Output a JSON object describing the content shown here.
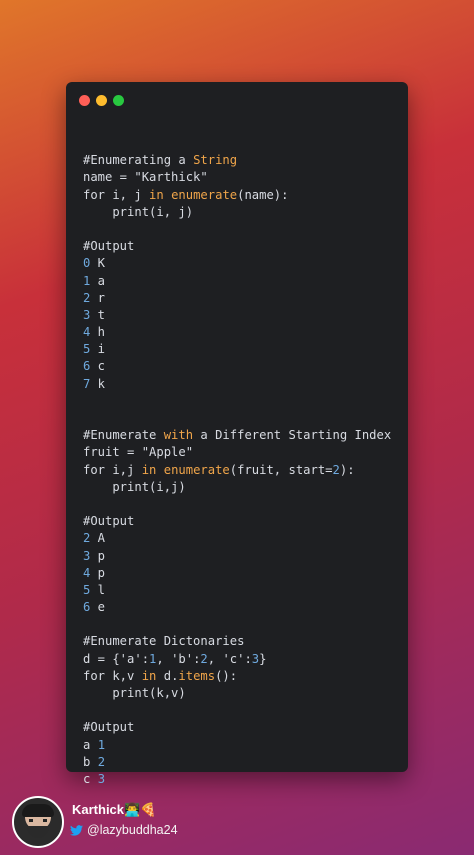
{
  "code": {
    "lines": [
      "",
      [
        {
          "t": "#Enumerating a ",
          "c": "txt"
        },
        {
          "t": "String",
          "c": "kw"
        }
      ],
      [
        {
          "t": "name = \"Karthick\"",
          "c": "txt"
        }
      ],
      [
        {
          "t": "for i, j ",
          "c": "txt"
        },
        {
          "t": "in",
          "c": "kw"
        },
        {
          "t": " ",
          "c": "txt"
        },
        {
          "t": "enumerate",
          "c": "fn"
        },
        {
          "t": "(name):",
          "c": "txt"
        }
      ],
      [
        {
          "t": "    print(i, j)",
          "c": "txt"
        }
      ],
      "",
      [
        {
          "t": "#Output",
          "c": "txt"
        }
      ],
      [
        {
          "t": "0",
          "c": "num"
        },
        {
          "t": " K",
          "c": "txt"
        }
      ],
      [
        {
          "t": "1",
          "c": "num"
        },
        {
          "t": " a",
          "c": "txt"
        }
      ],
      [
        {
          "t": "2",
          "c": "num"
        },
        {
          "t": " r",
          "c": "txt"
        }
      ],
      [
        {
          "t": "3",
          "c": "num"
        },
        {
          "t": " t",
          "c": "txt"
        }
      ],
      [
        {
          "t": "4",
          "c": "num"
        },
        {
          "t": " h",
          "c": "txt"
        }
      ],
      [
        {
          "t": "5",
          "c": "num"
        },
        {
          "t": " i",
          "c": "txt"
        }
      ],
      [
        {
          "t": "6",
          "c": "num"
        },
        {
          "t": " c",
          "c": "txt"
        }
      ],
      [
        {
          "t": "7",
          "c": "num"
        },
        {
          "t": " k",
          "c": "txt"
        }
      ],
      "",
      "",
      [
        {
          "t": "#Enumerate ",
          "c": "txt"
        },
        {
          "t": "with",
          "c": "kw"
        },
        {
          "t": " a Different Starting Index",
          "c": "txt"
        }
      ],
      [
        {
          "t": "fruit = \"Apple\"",
          "c": "txt"
        }
      ],
      [
        {
          "t": "for i,j ",
          "c": "txt"
        },
        {
          "t": "in",
          "c": "kw"
        },
        {
          "t": " ",
          "c": "txt"
        },
        {
          "t": "enumerate",
          "c": "fn"
        },
        {
          "t": "(fruit, start=",
          "c": "txt"
        },
        {
          "t": "2",
          "c": "num"
        },
        {
          "t": "):",
          "c": "txt"
        }
      ],
      [
        {
          "t": "    print(i,j)",
          "c": "txt"
        }
      ],
      "",
      [
        {
          "t": "#Output",
          "c": "txt"
        }
      ],
      [
        {
          "t": "2",
          "c": "num"
        },
        {
          "t": " A",
          "c": "txt"
        }
      ],
      [
        {
          "t": "3",
          "c": "num"
        },
        {
          "t": " p",
          "c": "txt"
        }
      ],
      [
        {
          "t": "4",
          "c": "num"
        },
        {
          "t": " p",
          "c": "txt"
        }
      ],
      [
        {
          "t": "5",
          "c": "num"
        },
        {
          "t": " l",
          "c": "txt"
        }
      ],
      [
        {
          "t": "6",
          "c": "num"
        },
        {
          "t": " e",
          "c": "txt"
        }
      ],
      "",
      [
        {
          "t": "#Enumerate Dictonaries",
          "c": "txt"
        }
      ],
      [
        {
          "t": "d = {'a':",
          "c": "txt"
        },
        {
          "t": "1",
          "c": "num"
        },
        {
          "t": ", 'b':",
          "c": "txt"
        },
        {
          "t": "2",
          "c": "num"
        },
        {
          "t": ", 'c':",
          "c": "txt"
        },
        {
          "t": "3",
          "c": "num"
        },
        {
          "t": "}",
          "c": "txt"
        }
      ],
      [
        {
          "t": "for k,v ",
          "c": "txt"
        },
        {
          "t": "in",
          "c": "kw"
        },
        {
          "t": " d.",
          "c": "txt"
        },
        {
          "t": "items",
          "c": "fn"
        },
        {
          "t": "():",
          "c": "txt"
        }
      ],
      [
        {
          "t": "    print(k,v)",
          "c": "txt"
        }
      ],
      "",
      [
        {
          "t": "#Output",
          "c": "txt"
        }
      ],
      [
        {
          "t": "a ",
          "c": "txt"
        },
        {
          "t": "1",
          "c": "num"
        }
      ],
      [
        {
          "t": "b ",
          "c": "txt"
        },
        {
          "t": "2",
          "c": "num"
        }
      ],
      [
        {
          "t": "c ",
          "c": "txt"
        },
        {
          "t": "3",
          "c": "num"
        }
      ]
    ]
  },
  "footer": {
    "author_name": "Karthick👨‍💻🍕",
    "handle": "@lazybuddha24",
    "icons": [
      "avatar",
      "twitter-icon"
    ]
  },
  "colors": {
    "keyword": "#f0a54a",
    "number": "#6fa9de",
    "text": "#d8dbe2",
    "window_bg": "#1e1f22"
  }
}
